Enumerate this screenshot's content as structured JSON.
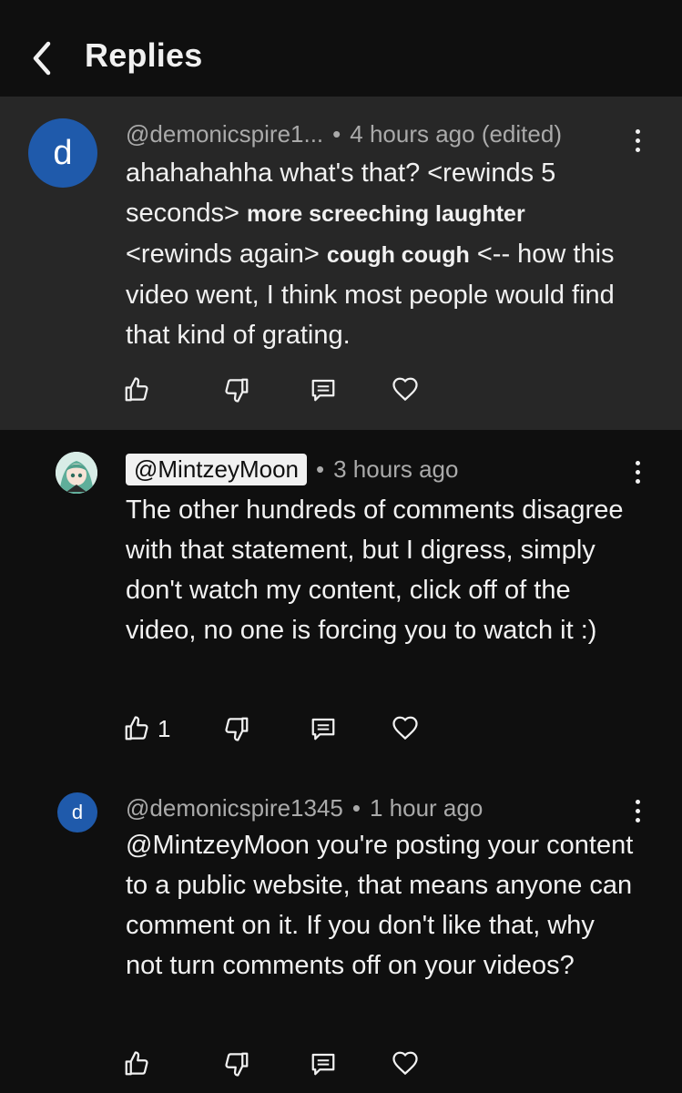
{
  "header": {
    "title": "Replies",
    "back_icon": "chevron-left-icon"
  },
  "comments": [
    {
      "avatar_letter": "d",
      "avatar_color": "#1f5aab",
      "handle": "@demonicspire1...",
      "time": "4 hours ago (edited)",
      "text_parts": [
        "ahahahahha what's that? <rewinds 5 seconds> ",
        "more screeching laughter",
        " <rewinds again> ",
        "cough cough",
        " <-- how this video went, I think most people would find that kind of grating."
      ],
      "likes": ""
    },
    {
      "avatar_icon": "anime-avatar-icon",
      "handle": "@MintzeyMoon",
      "time": "3 hours ago",
      "text": "The other hundreds of comments disagree with that statement, but I digress, simply don't watch my content, click off of the video, no one is forcing you to watch it :)",
      "likes": "1"
    },
    {
      "avatar_letter": "d",
      "avatar_color": "#1f5aab",
      "handle": "@demonicspire1345",
      "time": "1 hour ago",
      "text": "@MintzeyMoon you're posting your content to a public website, that means anyone can comment on it. If you don't like that, why not turn comments off on your videos?",
      "likes": ""
    }
  ],
  "separator": "•",
  "colors": {
    "background": "#0f0f0f",
    "highlight": "#272727",
    "meta_text": "#aaaaaa",
    "avatar_blue": "#1f5aab"
  }
}
